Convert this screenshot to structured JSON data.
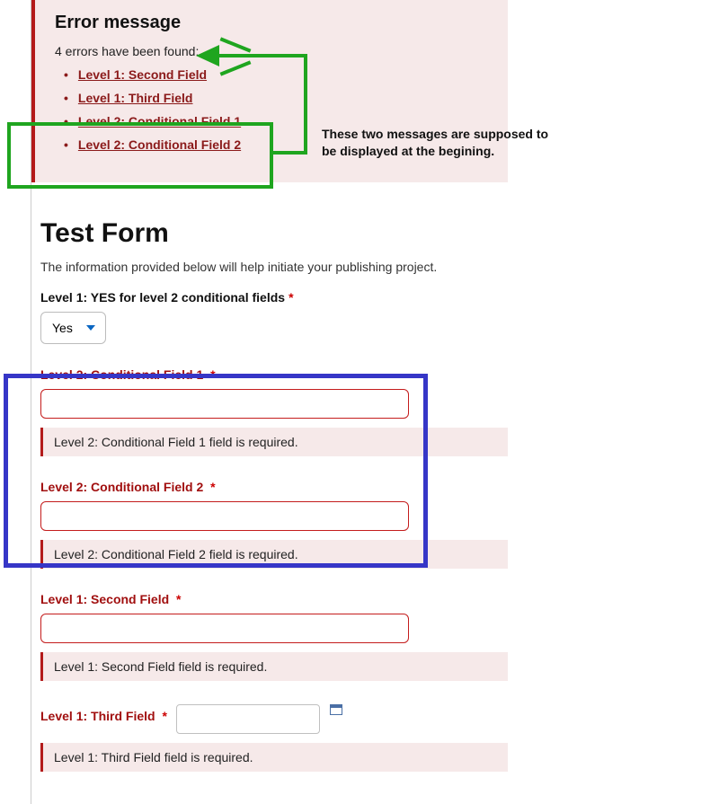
{
  "error_summary": {
    "heading": "Error message",
    "count_text": "4 errors have been found:",
    "items": [
      {
        "label": "Level 1: Second Field"
      },
      {
        "label": "Level 1: Third Field"
      },
      {
        "label": "Level 2: Conditional Field 1"
      },
      {
        "label": "Level 2: Conditional Field 2"
      }
    ]
  },
  "annotation": {
    "text": "These two messages are supposed to be displayed at the begining."
  },
  "form": {
    "title": "Test Form",
    "intro": "The information provided below will help initiate your publishing project.",
    "level1_toggle": {
      "label": "Level 1: YES for level 2 conditional fields",
      "value": "Yes"
    },
    "cond1": {
      "label": "Level 2: Conditional Field 1",
      "value": "",
      "error": "Level 2: Conditional Field 1 field is required."
    },
    "cond2": {
      "label": "Level 2: Conditional Field 2",
      "value": "",
      "error": "Level 2: Conditional Field 2 field is required."
    },
    "second": {
      "label": "Level 1: Second Field",
      "value": "",
      "error": "Level 1: Second Field field is required."
    },
    "third": {
      "label": "Level 1: Third Field",
      "value": "",
      "error": "Level 1: Third Field field is required."
    }
  }
}
